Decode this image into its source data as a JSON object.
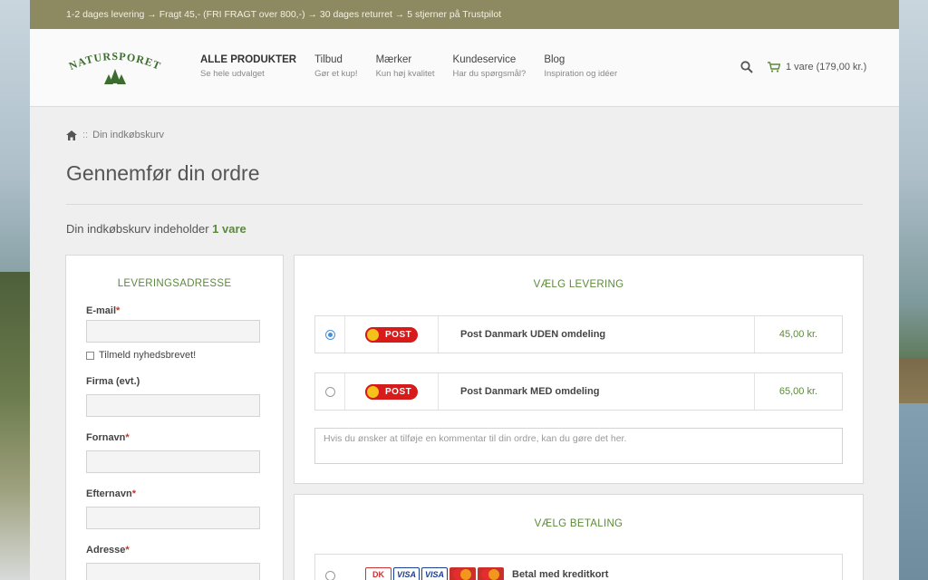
{
  "topbar": {
    "text": "1-2 dages levering → Fragt 45,- (FRI FRAGT over 800,-) → 30 dages returret → 5 stjerner på Trustpilot"
  },
  "logo": {
    "text": "NATURSPORET"
  },
  "nav": [
    {
      "title": "ALLE PRODUKTER",
      "subtitle": "Se hele udvalget"
    },
    {
      "title": "Tilbud",
      "subtitle": "Gør et kup!"
    },
    {
      "title": "Mærker",
      "subtitle": "Kun høj kvalitet"
    },
    {
      "title": "Kundeservice",
      "subtitle": "Har du spørgsmål?"
    },
    {
      "title": "Blog",
      "subtitle": "Inspiration og idéer"
    }
  ],
  "header": {
    "search_icon": "search-icon",
    "cart_icon": "cart-icon",
    "cart_label": "1 vare (179,00 kr.)"
  },
  "breadcrumb": {
    "home_icon": "home-icon",
    "separator": "::",
    "current": "Din indkøbskurv"
  },
  "page": {
    "title": "Gennemfør din ordre",
    "cart_prefix": "Din indkøbskurv indeholder",
    "cart_count": "1 vare"
  },
  "address": {
    "title": "LEVERINGSADRESSE",
    "email_label": "E-mail",
    "newsletter_label": "Tilmeld nyhedsbrevet!",
    "company_label": "Firma (evt.)",
    "firstname_label": "Fornavn",
    "lastname_label": "Efternavn",
    "address_label": "Adresse",
    "required_mark": "*"
  },
  "shipping": {
    "title": "VÆLG LEVERING",
    "options": [
      {
        "logo_text": "POST",
        "name": "Post Danmark UDEN omdeling",
        "price": "45,00 kr.",
        "selected": true
      },
      {
        "logo_text": "POST",
        "name": "Post Danmark MED omdeling",
        "price": "65,00 kr.",
        "selected": false
      }
    ],
    "comment_placeholder": "Hvis du ønsker at tilføje en kommentar til din ordre, kan du gøre det her."
  },
  "payment": {
    "title": "VÆLG BETALING",
    "cards": [
      "DK",
      "VISA",
      "VISA"
    ],
    "method_label": "Betal med kreditkort"
  },
  "colors": {
    "accent": "#5b8a3a",
    "topbar": "#8d8a62",
    "radio_selected": "#4a8fd8",
    "post_red": "#d71a1a"
  }
}
